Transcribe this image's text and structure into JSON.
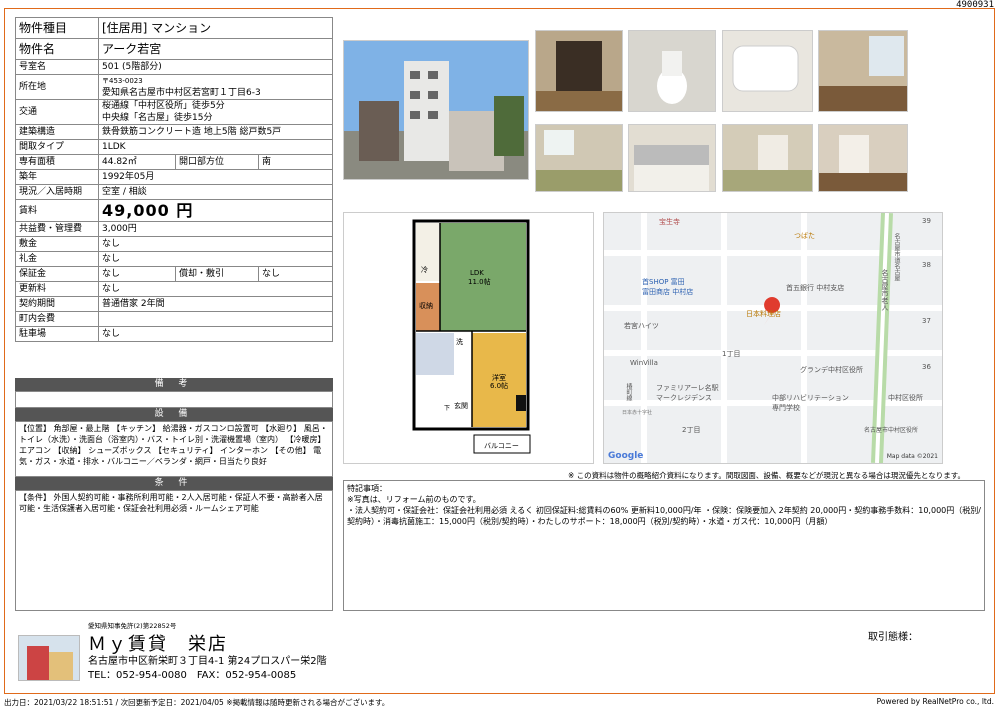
{
  "doc_id": "4900931",
  "spec": {
    "type_label": "物件種目",
    "type_value": "[住居用] マンション",
    "name_label": "物件名",
    "name_value": "アーク若宮",
    "room_label": "号室名",
    "room_value": "501 (5階部分)",
    "addr_label": "所在地",
    "addr_zip": "〒453-0023",
    "addr_value": "愛知県名古屋市中村区若宮町１丁目6-3",
    "traffic_label": "交通",
    "traffic_1": "桜通線「中村区役所」徒歩5分",
    "traffic_2": "中央線「名古屋」徒歩15分",
    "structure_label": "建築構造",
    "structure_value": "鉄骨鉄筋コンクリート造 地上5階 総戸数5戸",
    "layout_label": "間取タイプ",
    "layout_value": "1LDK",
    "area_label": "専有面積",
    "area_value": "44.82㎡",
    "direction_label": "開口部方位",
    "direction_value": "南",
    "built_label": "築年",
    "built_value": "1992年05月",
    "status_label": "現況／入居時期",
    "status_value": "空室 / 相談",
    "rent_label": "賃料",
    "rent_value": "49,000 円",
    "fee_label": "共益費・管理費",
    "fee_value": "3,000円",
    "shiki_label": "敷金",
    "shiki_value": "なし",
    "rei_label": "礼金",
    "rei_value": "なし",
    "deposit_label": "保証金",
    "deposit_value": "なし",
    "shokyaku_label": "償却・敷引",
    "shokyaku_value": "なし",
    "renew_label": "更新料",
    "renew_value": "なし",
    "contract_label": "契約期間",
    "contract_value": "普通借家 2年間",
    "chokai_label": "町内会費",
    "chokai_value": "",
    "parking_label": "駐車場",
    "parking_value": "なし"
  },
  "sections": {
    "biko": "備 考",
    "setsubi": "設 備",
    "setsubi_text": "【位置】 角部屋・最上階 【キッチン】 給湯器・ガスコンロ設置可 【水廻り】 風呂・トイレ（水洗）・洗面台（浴室内）・バス・トイレ別・洗濯機置場（室内） 【冷暖房】 エアコン 【収納】 シューズボックス 【セキュリティ】 インターホン 【その他】 電気・ガス・水道・排水・バルコニー／ベランダ・網戸・日当たり良好",
    "joken": "条 件",
    "joken_text": "【条件】 外国人契約可能・事務所利用可能・2人入居可能・保証人不要・高齢者入居可能・生活保護者入居可能・保証会社利用必須・ルームシェア可能"
  },
  "floorplan": {
    "ldk": "LDK",
    "ldk_size": "11.0帖",
    "western": "洋室",
    "western_size": "6.0帖",
    "rei": "冷",
    "storage": "収納",
    "sen": "洗",
    "genkan": "玄関",
    "balcony": "バルコニー",
    "shita": "下"
  },
  "map": {
    "labels": [
      "宝生寺",
      "つばた",
      "首SHOP 富田",
      "富田商店 中村店",
      "首五銀行 中村支店",
      "若宮ハイツ",
      "名古屋市老人",
      "日本料理店",
      "WinVilla",
      "1丁目",
      "グランデ中村区役所",
      "ファミリアーレ名駅",
      "マークレジデンス",
      "中部リハビリテーション",
      "専門学校",
      "中村区役所",
      "日本赤十字社",
      "名古屋市中村区役所",
      "2丁目",
      "名古屋市道名古屋",
      "椿町線"
    ],
    "numbers": [
      "39",
      "38",
      "37",
      "36"
    ],
    "google": "Google",
    "credit": "Map data ©2021"
  },
  "notice": "※ この資料は物件の概略紹介資料になります。間取図面、設備、概要などが現況と異なる場合は現況優先となります。",
  "features": {
    "title": "特記事項：",
    "line1": "※写真は、リフォーム前のものです。",
    "line2": "・法人契約可・保証会社：保証会社利用必須 えるく 初回保証料:総賃料の60% 更新料10,000円/年 ・保険：保険要加入 2年契約 20,000円・契約事務手数料：10,000円（税別/契約時）・消毒抗菌施工：15,000円（税別/契約時）・わたしのサポート：18,000円（税別/契約時）・水道・ガス代：10,000円（月額）"
  },
  "company": {
    "license": "愛知県知事免許(2)第22852号",
    "name": "Ｍｙ賃貸　栄店",
    "address": "名古屋市中区新栄町３丁目4-1 第24プロスパー栄2階",
    "tel": "TEL：052-954-0080　FAX：052-954-0085",
    "tori": "取引態様："
  },
  "bottom": {
    "left": "出力日：2021/03/22 18:51:51 / 次回更新予定日：2021/04/05 ※掲載情報は随時更新される場合がございます。",
    "right": "Powered by RealNetPro co., ltd."
  }
}
